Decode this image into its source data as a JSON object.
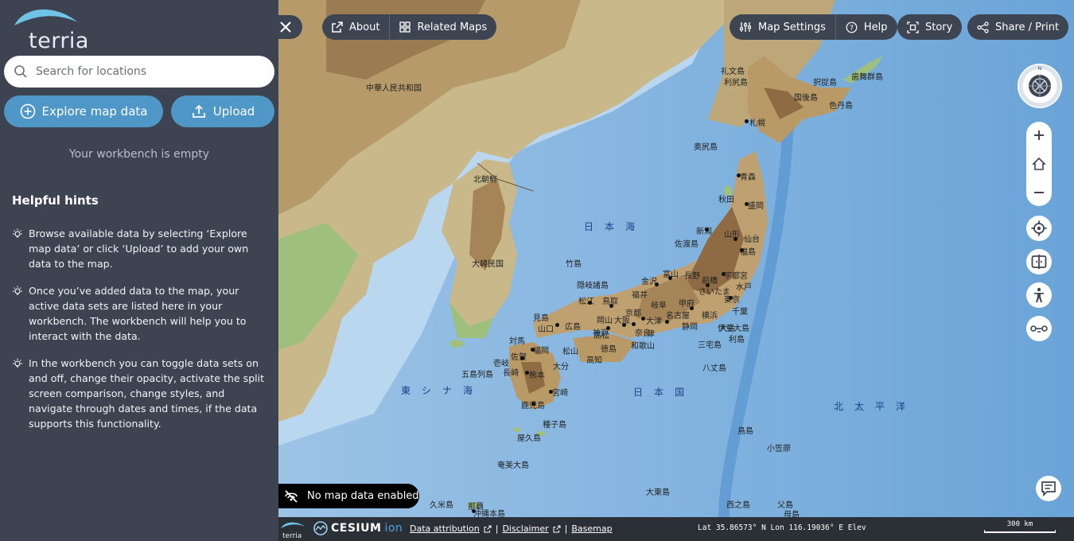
{
  "app": {
    "logo_text": "terria"
  },
  "search": {
    "placeholder": "Search for locations"
  },
  "sidebar": {
    "explore_label": "Explore map data",
    "upload_label": "Upload",
    "workbench_empty": "Your workbench is empty",
    "hints_title": "Helpful hints",
    "hints": [
      "Browse available data by selecting ‘Explore map data’ or click ‘Upload’ to add your own data to the map.",
      "Once you’ve added data to the map, your active data sets are listed here in your workbench. The workbench will help you to interact with the data.",
      "In the workbench you can toggle data sets on and off, change their opacity, activate the split screen comparison, change styles, and navigate through dates and times, if the data supports this functionality."
    ]
  },
  "toolbar": {
    "about": "About",
    "related_maps": "Related Maps",
    "map_settings": "Map Settings",
    "help": "Help",
    "story": "Story",
    "share": "Share / Print"
  },
  "map": {
    "no_data": "No map data enabled",
    "compass_north": "N",
    "seas": {
      "japan_sea": "日本海",
      "east_china_sea": "東シナ海",
      "pacific": "北太平洋",
      "japan_country": "日本国"
    },
    "places": [
      "中華人民共和国",
      "北朝鮮",
      "大韓民国",
      "礼文島",
      "利尻島",
      "札幌",
      "奥尻島",
      "青森",
      "秋田",
      "盛岡",
      "山形",
      "仙台",
      "福島",
      "新潟",
      "佐渡島",
      "宇都宮",
      "水戸",
      "前橋",
      "長野",
      "富山",
      "金沢",
      "福井",
      "さいたま",
      "東京",
      "千葉",
      "横浜",
      "甲府",
      "静岡",
      "名古屋",
      "岐阜",
      "津",
      "大津",
      "京都",
      "奈良",
      "大阪",
      "神戸",
      "和歌山",
      "鳥取",
      "松江",
      "岡山",
      "広島",
      "山口",
      "徳島",
      "高松",
      "松山",
      "高知",
      "福岡",
      "佐賀",
      "長崎",
      "熊本",
      "大分",
      "宮崎",
      "鹿児島",
      "隠岐諸島",
      "竹島",
      "見島",
      "対馬",
      "壱岐",
      "五島列島",
      "屋久島",
      "種子島",
      "奄美大島",
      "沖縄本島",
      "伊豆大島",
      "三宅島",
      "八丈島",
      "鳥島",
      "西之島",
      "父島",
      "母島",
      "那覇",
      "久米島",
      "大東島",
      "択捉島",
      "国後島",
      "色丹島",
      "歯舞群島",
      "大島",
      "小笠原",
      "利島"
    ]
  },
  "footer": {
    "cesium": "CESIUM",
    "ion": "ion",
    "data_attribution": "Data attribution",
    "disclaimer": "Disclaimer",
    "basemap": "Basemap",
    "coords": "Lat  35.86573° N   Lon  116.19036° E  Elev",
    "scale": "300 km"
  },
  "colors": {
    "sidebar_bg": "#3d4351",
    "accent_blue": "#4f97c7",
    "pill_bg": "#3e4552",
    "ocean": "#7fb0dc"
  }
}
